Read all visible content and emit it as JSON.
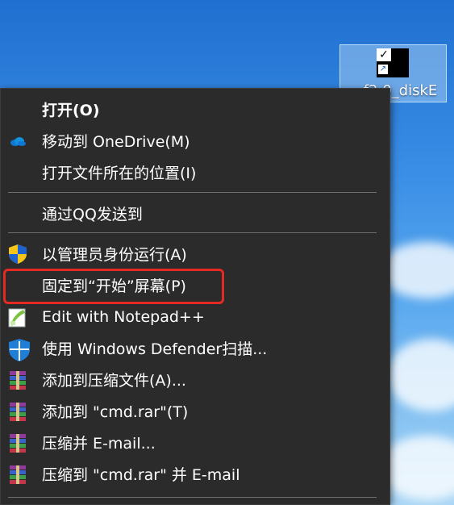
{
  "desktop_icon": {
    "label": "cmd_diskE",
    "label_visible": "…f2.0_diskE"
  },
  "menu": {
    "items": [
      {
        "label": "打开(O)",
        "bold": true,
        "icon": ""
      },
      {
        "label": "移动到 OneDrive(M)",
        "icon": "onedrive-cloud-icon"
      },
      {
        "label": "打开文件所在的位置(I)",
        "icon": ""
      },
      {
        "label": "通过QQ发送到",
        "icon": ""
      },
      {
        "label": "以管理员身份运行(A)",
        "icon": "uac-shield-icon"
      },
      {
        "label": "固定到“开始”屏幕(P)",
        "icon": "",
        "highlighted": true
      },
      {
        "label": "Edit with Notepad++",
        "icon": "notepad-plus-plus-icon"
      },
      {
        "label": "使用 Windows Defender扫描...",
        "icon": "windows-defender-icon"
      },
      {
        "label": "添加到压缩文件(A)...",
        "icon": "winrar-icon"
      },
      {
        "label": "添加到 \"cmd.rar\"(T)",
        "icon": "winrar-icon"
      },
      {
        "label": "压缩并 E-mail...",
        "icon": "winrar-icon"
      },
      {
        "label": "压缩到 \"cmd.rar\" 并 E-mail",
        "icon": "winrar-icon"
      }
    ]
  },
  "colors": {
    "menu_bg": "#2b2b2b",
    "highlight_border": "#e42a22",
    "text": "#ffffff"
  }
}
